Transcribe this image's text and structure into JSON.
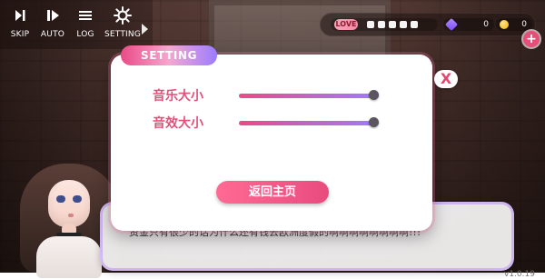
{
  "toolbar": {
    "items": [
      {
        "label": "SKIP",
        "icon": "skip-icon"
      },
      {
        "label": "AUTO",
        "icon": "auto-play-icon"
      },
      {
        "label": "LOG",
        "icon": "log-list-icon"
      },
      {
        "label": "SETTING",
        "icon": "gear-icon"
      }
    ],
    "more_icon": "chevron-right-icon"
  },
  "status": {
    "hearts_logo_text": "LOVE",
    "hearts_filled": 5,
    "gem_value": "0",
    "coin_value": "0",
    "add_icon": "plus-icon"
  },
  "settings_modal": {
    "title": "SETTING",
    "close_label": "X",
    "music_label": "音乐大小",
    "music_level": 1.0,
    "sfx_label": "音效大小",
    "sfx_level": 1.0,
    "home_button_label": "返回主页",
    "version": "v1.0.19"
  },
  "dialogue": {
    "text": "资金只有很少的话为什么还有钱去欧洲度假的啊啊啊啊啊啊啊啊!!!"
  },
  "colors": {
    "accent_pink": "#e94b86",
    "accent_purple": "#9b7dff"
  }
}
